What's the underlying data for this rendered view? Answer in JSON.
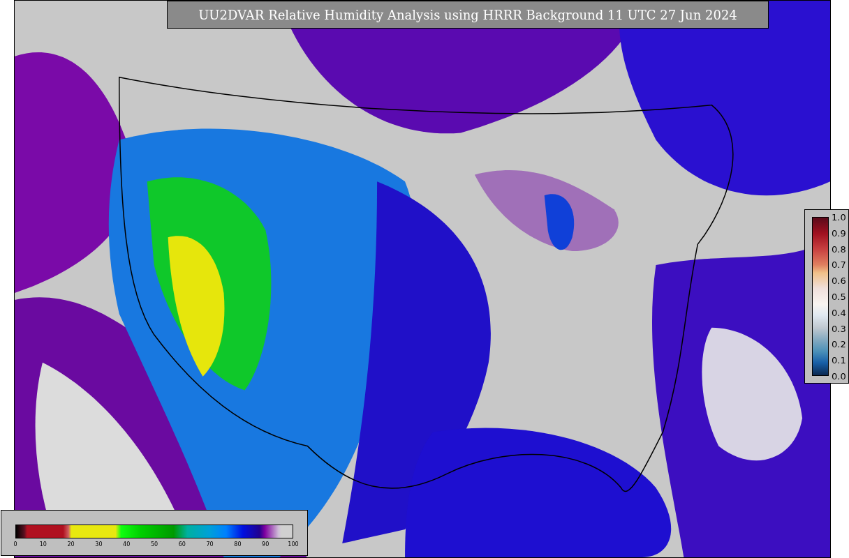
{
  "title": "UU2DVAR Relative Humidity Analysis using HRRR Background 11 UTC 27 Jun 2024",
  "humidity_colorbar": {
    "ticks": [
      "0",
      "10",
      "20",
      "30",
      "40",
      "50",
      "60",
      "70",
      "80",
      "90",
      "100"
    ]
  },
  "observation_colorbar": {
    "ticks": [
      "1.0",
      "0.9",
      "0.8",
      "0.7",
      "0.6",
      "0.5",
      "0.4",
      "0.3",
      "0.2",
      "0.1",
      "0.0"
    ]
  }
}
